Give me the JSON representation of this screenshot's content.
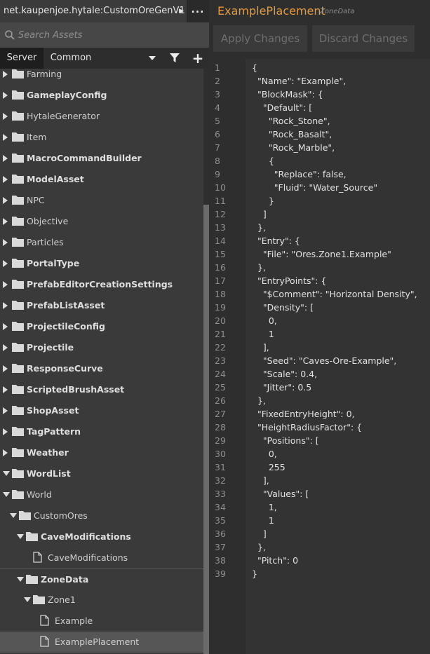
{
  "asset_tab": {
    "title": "net.kaupenjoe.hytale:CustomOreGenV1",
    "more": "..."
  },
  "search": {
    "placeholder": "Search Assets",
    "value": ""
  },
  "filter_tabs": {
    "server": "Server",
    "common": "Common"
  },
  "tree": [
    {
      "label": "Farming",
      "type": "folder",
      "expanded": false,
      "bold": false,
      "indent": 0
    },
    {
      "label": "GameplayConfig",
      "type": "folder",
      "expanded": false,
      "bold": true,
      "indent": 0
    },
    {
      "label": "HytaleGenerator",
      "type": "folder",
      "expanded": false,
      "bold": false,
      "indent": 0
    },
    {
      "label": "Item",
      "type": "folder",
      "expanded": false,
      "bold": false,
      "indent": 0
    },
    {
      "label": "MacroCommandBuilder",
      "type": "folder",
      "expanded": false,
      "bold": true,
      "indent": 0
    },
    {
      "label": "ModelAsset",
      "type": "folder",
      "expanded": false,
      "bold": true,
      "indent": 0
    },
    {
      "label": "NPC",
      "type": "folder",
      "expanded": false,
      "bold": false,
      "indent": 0
    },
    {
      "label": "Objective",
      "type": "folder",
      "expanded": false,
      "bold": false,
      "indent": 0
    },
    {
      "label": "Particles",
      "type": "folder",
      "expanded": false,
      "bold": false,
      "indent": 0
    },
    {
      "label": "PortalType",
      "type": "folder",
      "expanded": false,
      "bold": true,
      "indent": 0
    },
    {
      "label": "PrefabEditorCreationSettings",
      "type": "folder",
      "expanded": false,
      "bold": true,
      "indent": 0
    },
    {
      "label": "PrefabListAsset",
      "type": "folder",
      "expanded": false,
      "bold": true,
      "indent": 0
    },
    {
      "label": "ProjectileConfig",
      "type": "folder",
      "expanded": false,
      "bold": true,
      "indent": 0
    },
    {
      "label": "Projectile",
      "type": "folder",
      "expanded": false,
      "bold": true,
      "indent": 0
    },
    {
      "label": "ResponseCurve",
      "type": "folder",
      "expanded": false,
      "bold": true,
      "indent": 0
    },
    {
      "label": "ScriptedBrushAsset",
      "type": "folder",
      "expanded": false,
      "bold": true,
      "indent": 0
    },
    {
      "label": "ShopAsset",
      "type": "folder",
      "expanded": false,
      "bold": true,
      "indent": 0
    },
    {
      "label": "TagPattern",
      "type": "folder",
      "expanded": false,
      "bold": true,
      "indent": 0
    },
    {
      "label": "Weather",
      "type": "folder",
      "expanded": false,
      "bold": true,
      "indent": 0
    },
    {
      "label": "WordList",
      "type": "folder",
      "expanded": true,
      "bold": true,
      "indent": 0
    },
    {
      "label": "World",
      "type": "folder",
      "expanded": true,
      "bold": false,
      "indent": 0
    },
    {
      "label": "CustomOres",
      "type": "folder",
      "expanded": true,
      "bold": false,
      "indent": 1
    },
    {
      "label": "CaveModifications",
      "type": "folder",
      "expanded": true,
      "bold": true,
      "indent": 2
    },
    {
      "label": "CaveModifications",
      "type": "file",
      "expanded": false,
      "bold": false,
      "indent": 3
    },
    {
      "label": "ZoneData",
      "type": "folder",
      "expanded": true,
      "bold": true,
      "indent": 2
    },
    {
      "label": "Zone1",
      "type": "folder",
      "expanded": true,
      "bold": false,
      "indent": 3
    },
    {
      "label": "Example",
      "type": "file",
      "expanded": false,
      "bold": false,
      "indent": 4
    },
    {
      "label": "ExamplePlacement",
      "type": "file",
      "expanded": false,
      "bold": false,
      "indent": 4,
      "selected": true
    }
  ],
  "document": {
    "title": "ExamplePlacement",
    "type_label": "ZoneData"
  },
  "actions": {
    "apply": "Apply Changes",
    "discard": "Discard Changes"
  },
  "code_lines": [
    "{",
    "  \"Name\": \"Example\",",
    "  \"BlockMask\": {",
    "    \"Default\": [",
    "      \"Rock_Stone\",",
    "      \"Rock_Basalt\",",
    "      \"Rock_Marble\",",
    "      {",
    "        \"Replace\": false,",
    "        \"Fluid\": \"Water_Source\"",
    "      }",
    "    ]",
    "  },",
    "  \"Entry\": {",
    "    \"File\": \"Ores.Zone1.Example\"",
    "  },",
    "  \"EntryPoints\": {",
    "    \"$Comment\": \"Horizontal Density\",",
    "    \"Density\": [",
    "      0,",
    "      1",
    "    ],",
    "    \"Seed\": \"Caves-Ore-Example\",",
    "    \"Scale\": 0.4,",
    "    \"Jitter\": 0.5",
    "  },",
    "  \"FixedEntryHeight\": 0,",
    "  \"HeightRadiusFactor\": {",
    "    \"Positions\": [",
    "      0,",
    "      255",
    "    ],",
    "    \"Values\": [",
    "      1,",
    "      1",
    "    ]",
    "  },",
    "  \"Pitch\": 0",
    "}"
  ],
  "icons": {
    "asset_tab": "triangle-right-icon",
    "search": "magnifier-icon",
    "dropdown": "chevron-down-icon",
    "filter": "funnel-icon",
    "add": "plus-icon",
    "folder": "folder-icon",
    "file": "file-icon"
  },
  "colors": {
    "title": "#e59a3f",
    "selected_row": "#565656",
    "active_tab": "#1e1e1e"
  }
}
